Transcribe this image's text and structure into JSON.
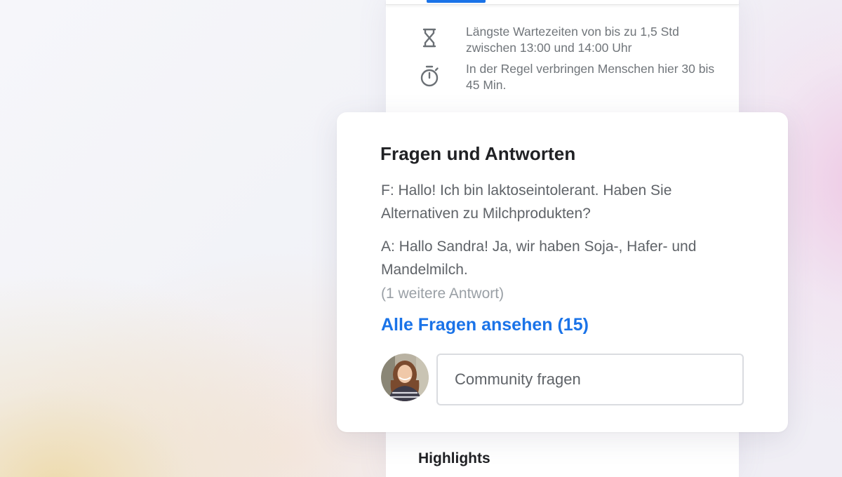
{
  "back_panel": {
    "wait_time": {
      "icon": "hourglass-icon",
      "text": "Längste Wartezeiten von bis zu 1,5 Std zwischen 13:00 und 14:00 Uhr"
    },
    "visit_duration": {
      "icon": "stopwatch-icon",
      "text": "In der Regel verbringen Menschen hier 30 bis 45 Min."
    },
    "highlights_heading": "Highlights"
  },
  "qa_card": {
    "title": "Fragen und Antworten",
    "question": "F: Hallo! Ich bin laktoseintolerant. Haben Sie Alternativen zu Milchprodukten?",
    "answer": "A: Hallo Sandra! Ja, wir haben Soja-, Hafer- und Mandelmilch.",
    "more_answers": "(1 weitere Antwort)",
    "all_questions_link": "Alle Fragen ansehen (15)",
    "ask_input": {
      "placeholder": "Community fragen",
      "value": ""
    }
  },
  "colors": {
    "accent": "#1a73e8",
    "text_primary": "#202124",
    "text_secondary": "#5f6368",
    "text_muted": "#9aa0a6"
  }
}
